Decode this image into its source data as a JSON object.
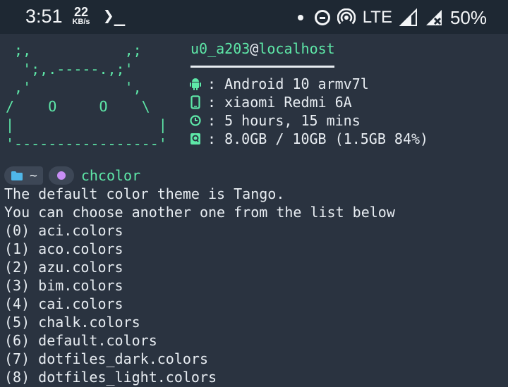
{
  "status_bar": {
    "time": "3:51",
    "net_speed": "22",
    "net_unit": "KB/s",
    "terminal_glyph": "❯_",
    "network": "LTE",
    "battery": "50%"
  },
  "ascii_art": [
    " ;,           ,;",
    "  ';,.-----.,;'",
    " ,'           ',",
    "/    O     O    \\",
    "|                 |",
    "'-----------------'"
  ],
  "sysinfo": {
    "user": "u0_a203",
    "at": "@",
    "host": "localhost",
    "rows": [
      {
        "icon": "android-icon",
        "text": ": Android 10 armv7l"
      },
      {
        "icon": "phone-icon",
        "text": ": xiaomi Redmi 6A"
      },
      {
        "icon": "clock-icon",
        "text": ": 5 hours, 15 mins"
      },
      {
        "icon": "storage-icon",
        "text": ": 8.0GB / 10GB (1.5GB 84%)"
      }
    ]
  },
  "prompt": {
    "dir": "~",
    "command": "chcolor"
  },
  "output": [
    "The default color theme is Tango.",
    "You can choose another one from the list below",
    "(0) aci.colors",
    "(1) aco.colors",
    "(2) azu.colors",
    "(3) bim.colors",
    "(4) cai.colors",
    "(5) chalk.colors",
    "(6) default.colors",
    "(7) dotfiles_dark.colors",
    "(8) dotfiles_light.colors"
  ],
  "colors": {
    "background": "#2a3340",
    "status_bar": "#1e2833",
    "accent_green": "#5ee8a8",
    "text": "#e8edf2",
    "folder_blue": "#4fb6e8",
    "prompt_purple": "#c88ef5"
  }
}
